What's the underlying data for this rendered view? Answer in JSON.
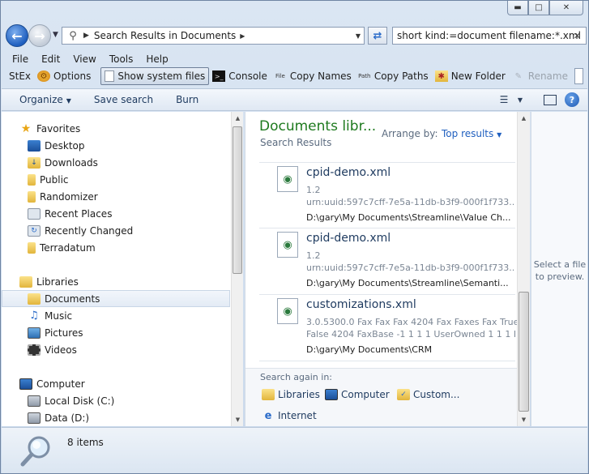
{
  "window": {
    "caption_buttons": [
      "minimize-icon",
      "maximize-icon",
      "close-icon"
    ]
  },
  "address": {
    "path": "Search Results in Documents",
    "search_query": "short  kind:=document  filename:*.xml"
  },
  "menu": [
    "File",
    "Edit",
    "View",
    "Tools",
    "Help"
  ],
  "stex": {
    "stex": "StEx",
    "options": "Options",
    "show_system_files": "Show system files",
    "console": "Console",
    "copy_names": "Copy Names",
    "copy_paths": "Copy Paths",
    "new_folder": "New Folder",
    "rename": "Rename"
  },
  "commands": {
    "organize": "Organize",
    "save_search": "Save search",
    "burn": "Burn"
  },
  "nav": {
    "favorites": "Favorites",
    "favorite_items": [
      "Desktop",
      "Downloads",
      "Public",
      "Randomizer",
      "Recent Places",
      "Recently Changed",
      "Terradatum"
    ],
    "libraries": "Libraries",
    "library_items": [
      "Documents",
      "Music",
      "Pictures",
      "Videos"
    ],
    "computer": "Computer",
    "computer_items": [
      "Local Disk (C:)",
      "Data (D:)"
    ]
  },
  "content": {
    "title": "Documents libr...",
    "subtitle": "Search Results",
    "arrange_label": "Arrange by:",
    "arrange_value": "Top results",
    "results": [
      {
        "name": "cpid-demo.xml",
        "line1": "1.2",
        "line2": "urn:uuid:597c7cff-7e5a-11db-b3f9-000f1f733...",
        "path": "D:\\gary\\My Documents\\Streamline\\Value Ch..."
      },
      {
        "name": "cpid-demo.xml",
        "line1": "1.2",
        "line2": "urn:uuid:597c7cff-7e5a-11db-b3f9-000f1f733...",
        "path": "D:\\gary\\My Documents\\Streamline\\Semanti..."
      },
      {
        "name": "customizations.xml",
        "line1": "3.0.5300.0 Fax Fax Fax 4204 Fax Faxes Fax True",
        "line2": "False 4204 FaxBase -1 1 1 1 UserOwned 1 1 1 F...",
        "path": "D:\\gary\\My Documents\\CRM"
      }
    ],
    "search_again_label": "Search again in:",
    "search_again": {
      "libraries": "Libraries",
      "computer": "Computer",
      "custom": "Custom...",
      "internet": "Internet"
    }
  },
  "preview": {
    "text_line1": "Select a file",
    "text_line2": "to preview."
  },
  "details": {
    "item_count": "8 items"
  },
  "colors": {
    "title_green": "#1e7a1e",
    "link_blue": "#1f5fbf",
    "chrome_blue": "#dbe6f3"
  }
}
